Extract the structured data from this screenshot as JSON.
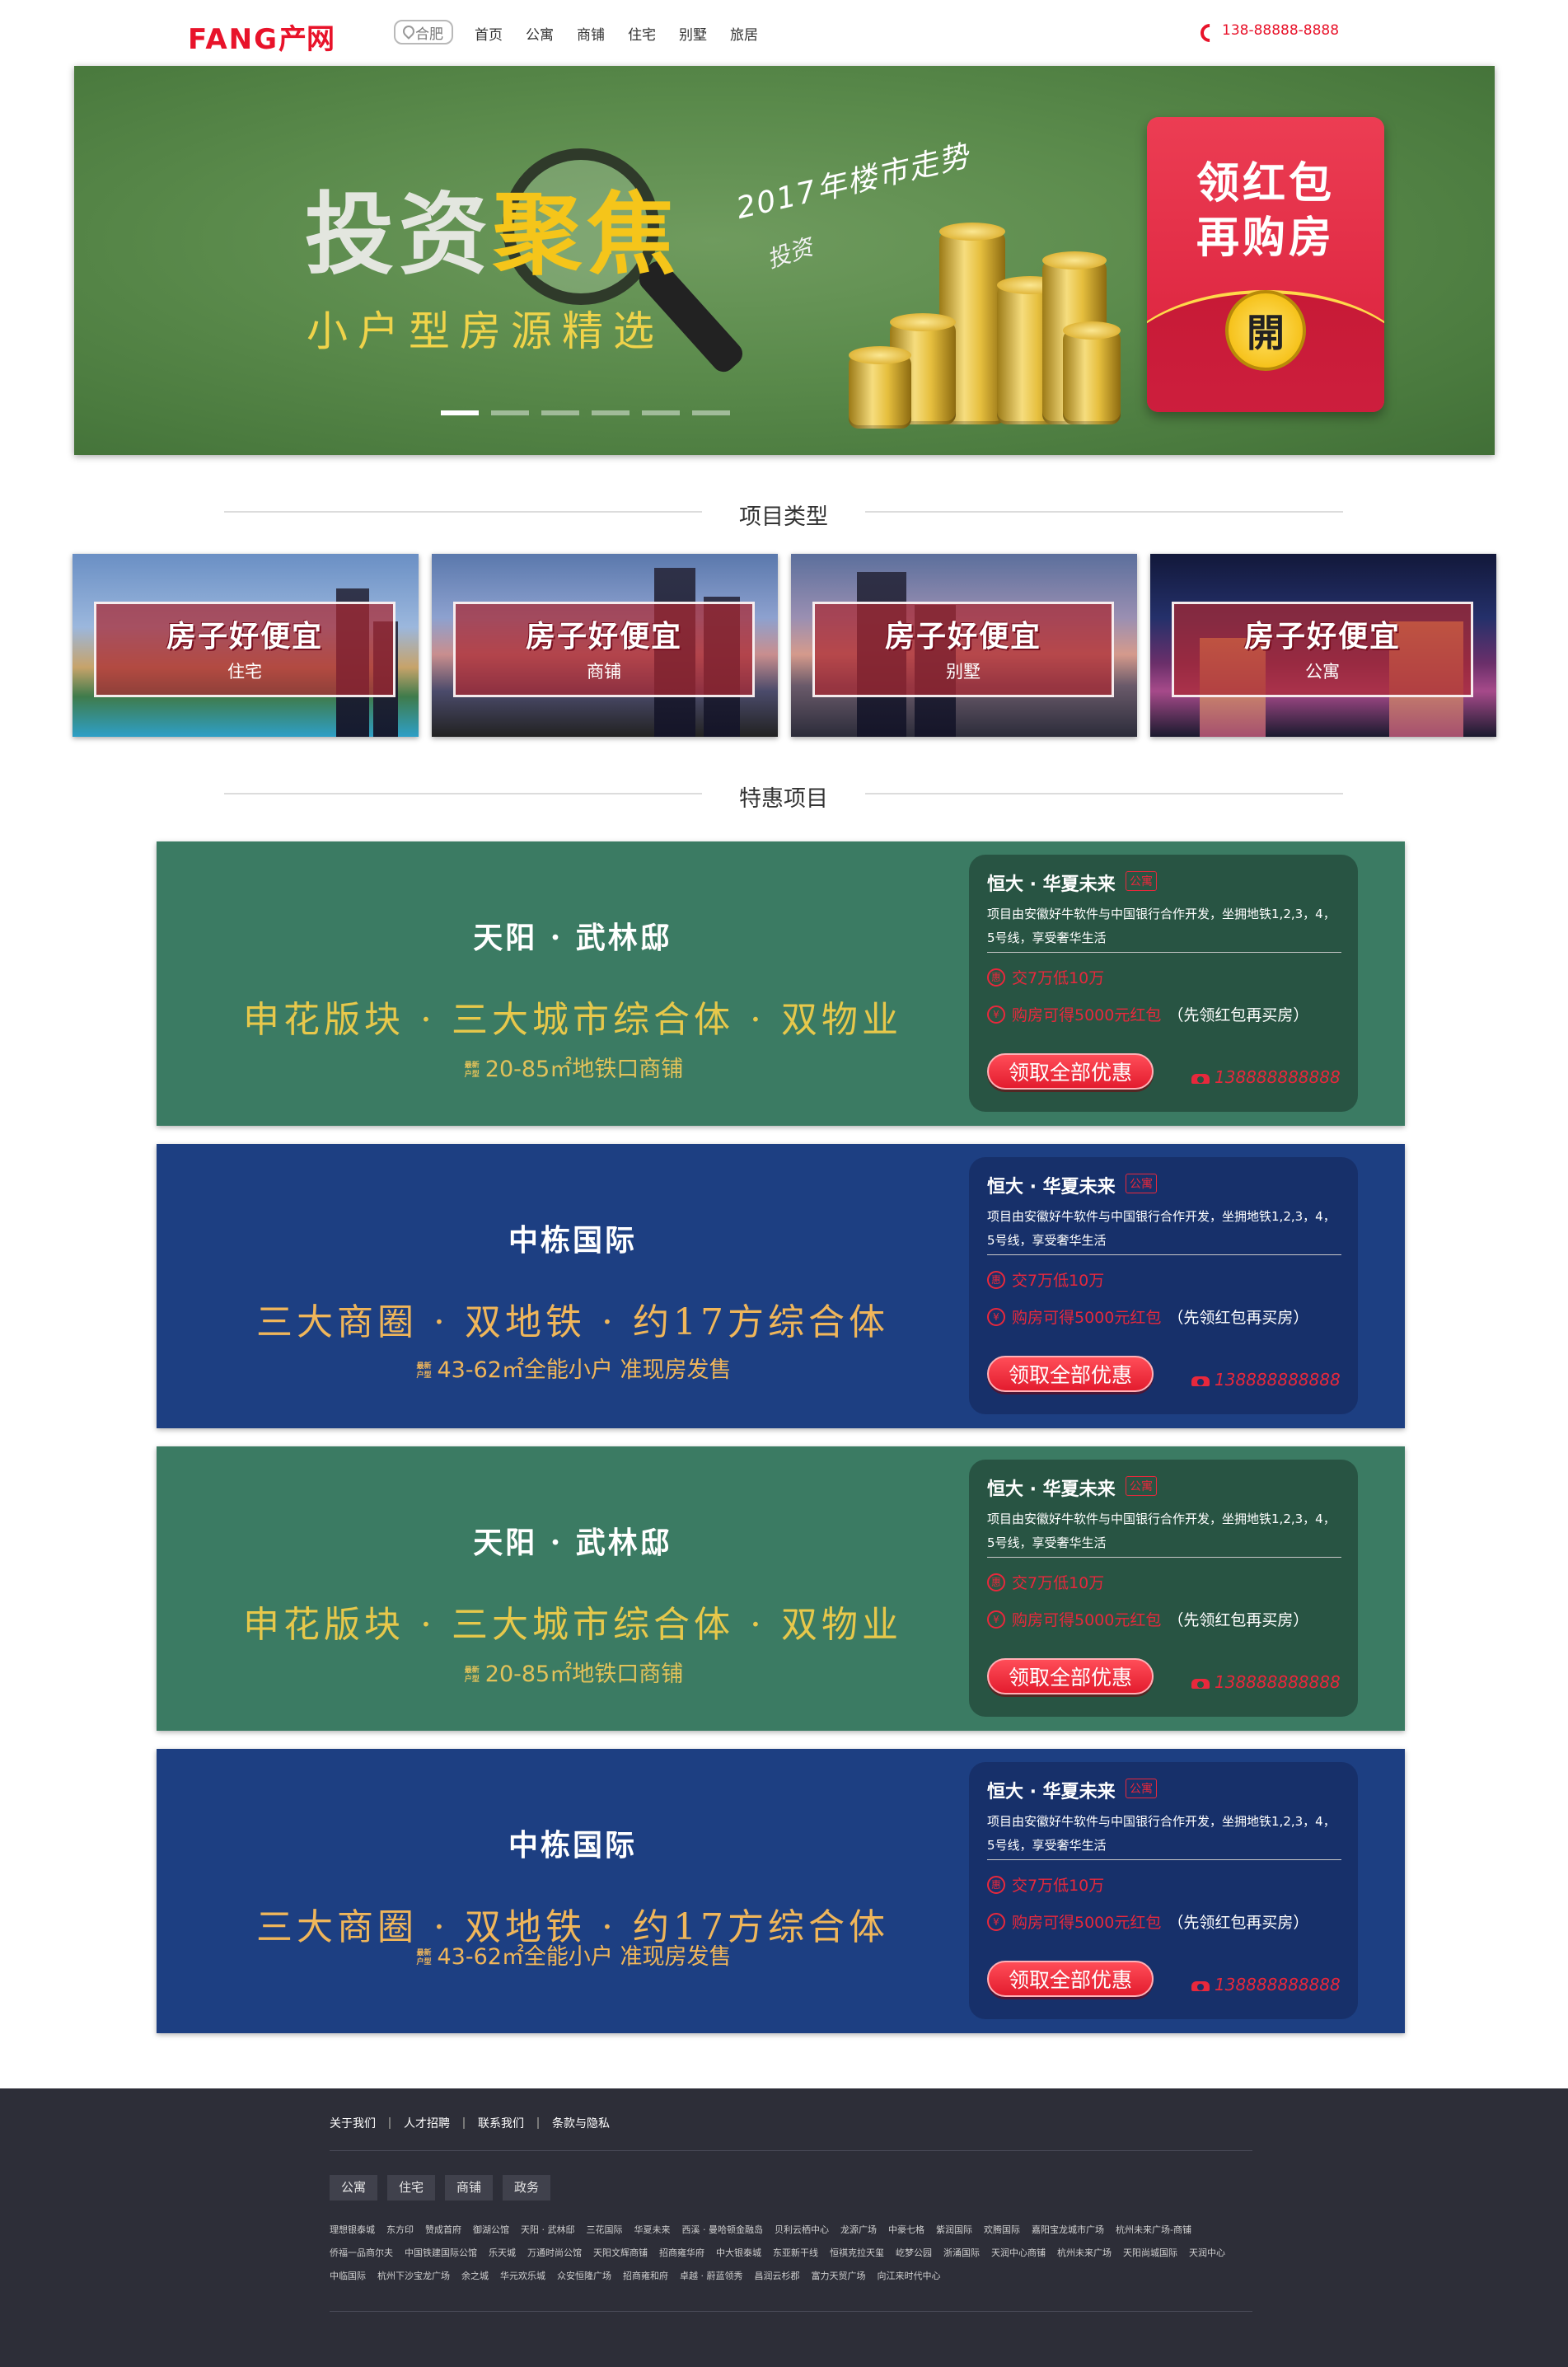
{
  "header": {
    "logo_latin": "FANG",
    "logo_cn": "产网",
    "city": "合肥",
    "menu": [
      "首页",
      "公寓",
      "商铺",
      "住宅",
      "别墅",
      "旅居"
    ],
    "phone": "138-88888-8888"
  },
  "banner": {
    "title_plain": "投资",
    "title_highlight": "聚焦",
    "subtitle": "小户型房源精选",
    "script_year": "2017年楼市走势",
    "script_word": "投资",
    "red_packet_line1": "领红包",
    "red_packet_line2": "再购房",
    "red_packet_coin": "開",
    "slide_count": 6,
    "active_slide": 1
  },
  "section_types": {
    "title": "项目类型",
    "tiles": [
      {
        "headline": "房子好便宜",
        "label": "住宅"
      },
      {
        "headline": "房子好便宜",
        "label": "商铺"
      },
      {
        "headline": "房子好便宜",
        "label": "别墅"
      },
      {
        "headline": "房子好便宜",
        "label": "公寓"
      }
    ]
  },
  "section_offers": {
    "title": "特惠项目",
    "cards": [
      {
        "theme": "green",
        "name": "天阳 · 武林邸",
        "slogan": "申花版块 · 三大城市综合体 · 双物业",
        "spec": "20-85㎡地铁口商铺",
        "panel_title": "恒大 · 华夏未来",
        "panel_tag": "公寓",
        "panel_desc": "项目由安徽好牛软件与中国银行合作开发，坐拥地铁1,2,3，4，5号线，享受奢华生活",
        "deal1_icon": "惠",
        "deal1": "交7万低10万",
        "deal2_icon": "¥",
        "deal2": "购房可得5000元红包",
        "deal2_note": "（先领红包再买房）",
        "button": "领取全部优惠",
        "tel": "138888888888"
      },
      {
        "theme": "blue",
        "name": "中栋国际",
        "slogan": "三大商圈 · 双地铁 · 约17方综合体",
        "spec": "43-62㎡全能小户  准现房发售",
        "panel_title": "恒大 · 华夏未来",
        "panel_tag": "公寓",
        "panel_desc": "项目由安徽好牛软件与中国银行合作开发，坐拥地铁1,2,3，4，5号线，享受奢华生活",
        "deal1_icon": "惠",
        "deal1": "交7万低10万",
        "deal2_icon": "¥",
        "deal2": "购房可得5000元红包",
        "deal2_note": "（先领红包再买房）",
        "button": "领取全部优惠",
        "tel": "138888888888"
      },
      {
        "theme": "green",
        "name": "天阳 · 武林邸",
        "slogan": "申花版块 · 三大城市综合体 · 双物业",
        "spec": "20-85㎡地铁口商铺",
        "panel_title": "恒大 · 华夏未来",
        "panel_tag": "公寓",
        "panel_desc": "项目由安徽好牛软件与中国银行合作开发，坐拥地铁1,2,3，4，5号线，享受奢华生活",
        "deal1_icon": "惠",
        "deal1": "交7万低10万",
        "deal2_icon": "¥",
        "deal2": "购房可得5000元红包",
        "deal2_note": "（先领红包再买房）",
        "button": "领取全部优惠",
        "tel": "138888888888"
      },
      {
        "theme": "blue",
        "name": "中栋国际",
        "slogan": "三大商圈 · 双地铁 · 约17方综合体",
        "spec": "43-62㎡全能小户  准现房发售",
        "panel_title": "恒大 · 华夏未来",
        "panel_tag": "公寓",
        "panel_desc": "项目由安徽好牛软件与中国银行合作开发，坐拥地铁1,2,3，4，5号线，享受奢华生活",
        "deal1_icon": "惠",
        "deal1": "交7万低10万",
        "deal2_icon": "¥",
        "deal2": "购房可得5000元红包",
        "deal2_note": "（先领红包再买房）",
        "button": "领取全部优惠",
        "tel": "138888888888"
      }
    ],
    "spec_mark": "最新\n户型"
  },
  "footer": {
    "links": [
      "关于我们",
      "人才招聘",
      "联系我们",
      "条款与隐私"
    ],
    "tabs": [
      "公寓",
      "住宅",
      "商铺",
      "政务"
    ],
    "projects": [
      "理想银泰城",
      "东方印",
      "赞成首府",
      "御湖公馆",
      "天阳 · 武林邸",
      "三花国际",
      "华夏未来",
      "西溪 · 曼哈顿金融岛",
      "贝利云栖中心",
      "龙源广场",
      "中豪七格",
      "紫润国际",
      "欢腾国际",
      "嘉阳宝龙城市广场",
      "杭州未来广场-商铺",
      "侨福一品商尔夫",
      "中国铁建国际公馆",
      "乐天城",
      "万通时尚公馆",
      "天阳文辉商铺",
      "招商雍华府",
      "中大银泰城",
      "东亚新干线",
      "恒祺克拉天玺",
      "屹梦公园",
      "浙涌国际",
      "天润中心商铺",
      "杭州未来广场",
      "天阳尚城国际",
      "天润中心",
      "中临国际",
      "杭州下沙宝龙广场",
      "余之城",
      "华元欢乐城",
      "众安恒隆广场",
      "招商雍和府",
      "卓越 · 蔚蓝领秀",
      "昌润云杉郡",
      "富力天贸广场",
      "向江来时代中心"
    ]
  },
  "colors": {
    "brand_red": "#e8132a",
    "banner_green": "#5a8a4b",
    "offer_green": "#3b7b63",
    "offer_blue": "#1d3f82",
    "footer_bg": "#2d2e38"
  }
}
